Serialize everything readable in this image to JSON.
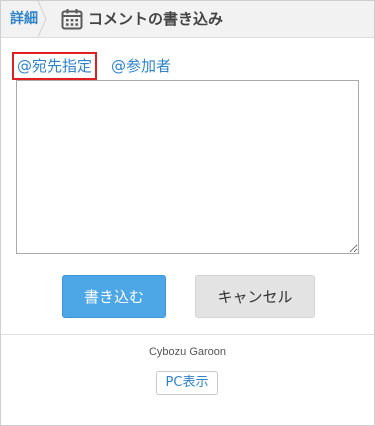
{
  "header": {
    "back_label": "詳細",
    "title": "コメントの書き込み",
    "title_icon": "calendar-icon"
  },
  "mentions": {
    "specify_label": "@宛先指定",
    "participants_label": "@参加者"
  },
  "comment": {
    "value": "",
    "placeholder": ""
  },
  "actions": {
    "submit_label": "書き込む",
    "cancel_label": "キャンセル"
  },
  "footer": {
    "brand": "Cybozu Garoon",
    "pc_view_label": "PC表示"
  },
  "colors": {
    "link": "#2f83c9",
    "primary_button": "#4da6e6",
    "secondary_button": "#e3e3e3",
    "highlight_border": "#e02020",
    "header_bg": "#f2f2f2"
  }
}
